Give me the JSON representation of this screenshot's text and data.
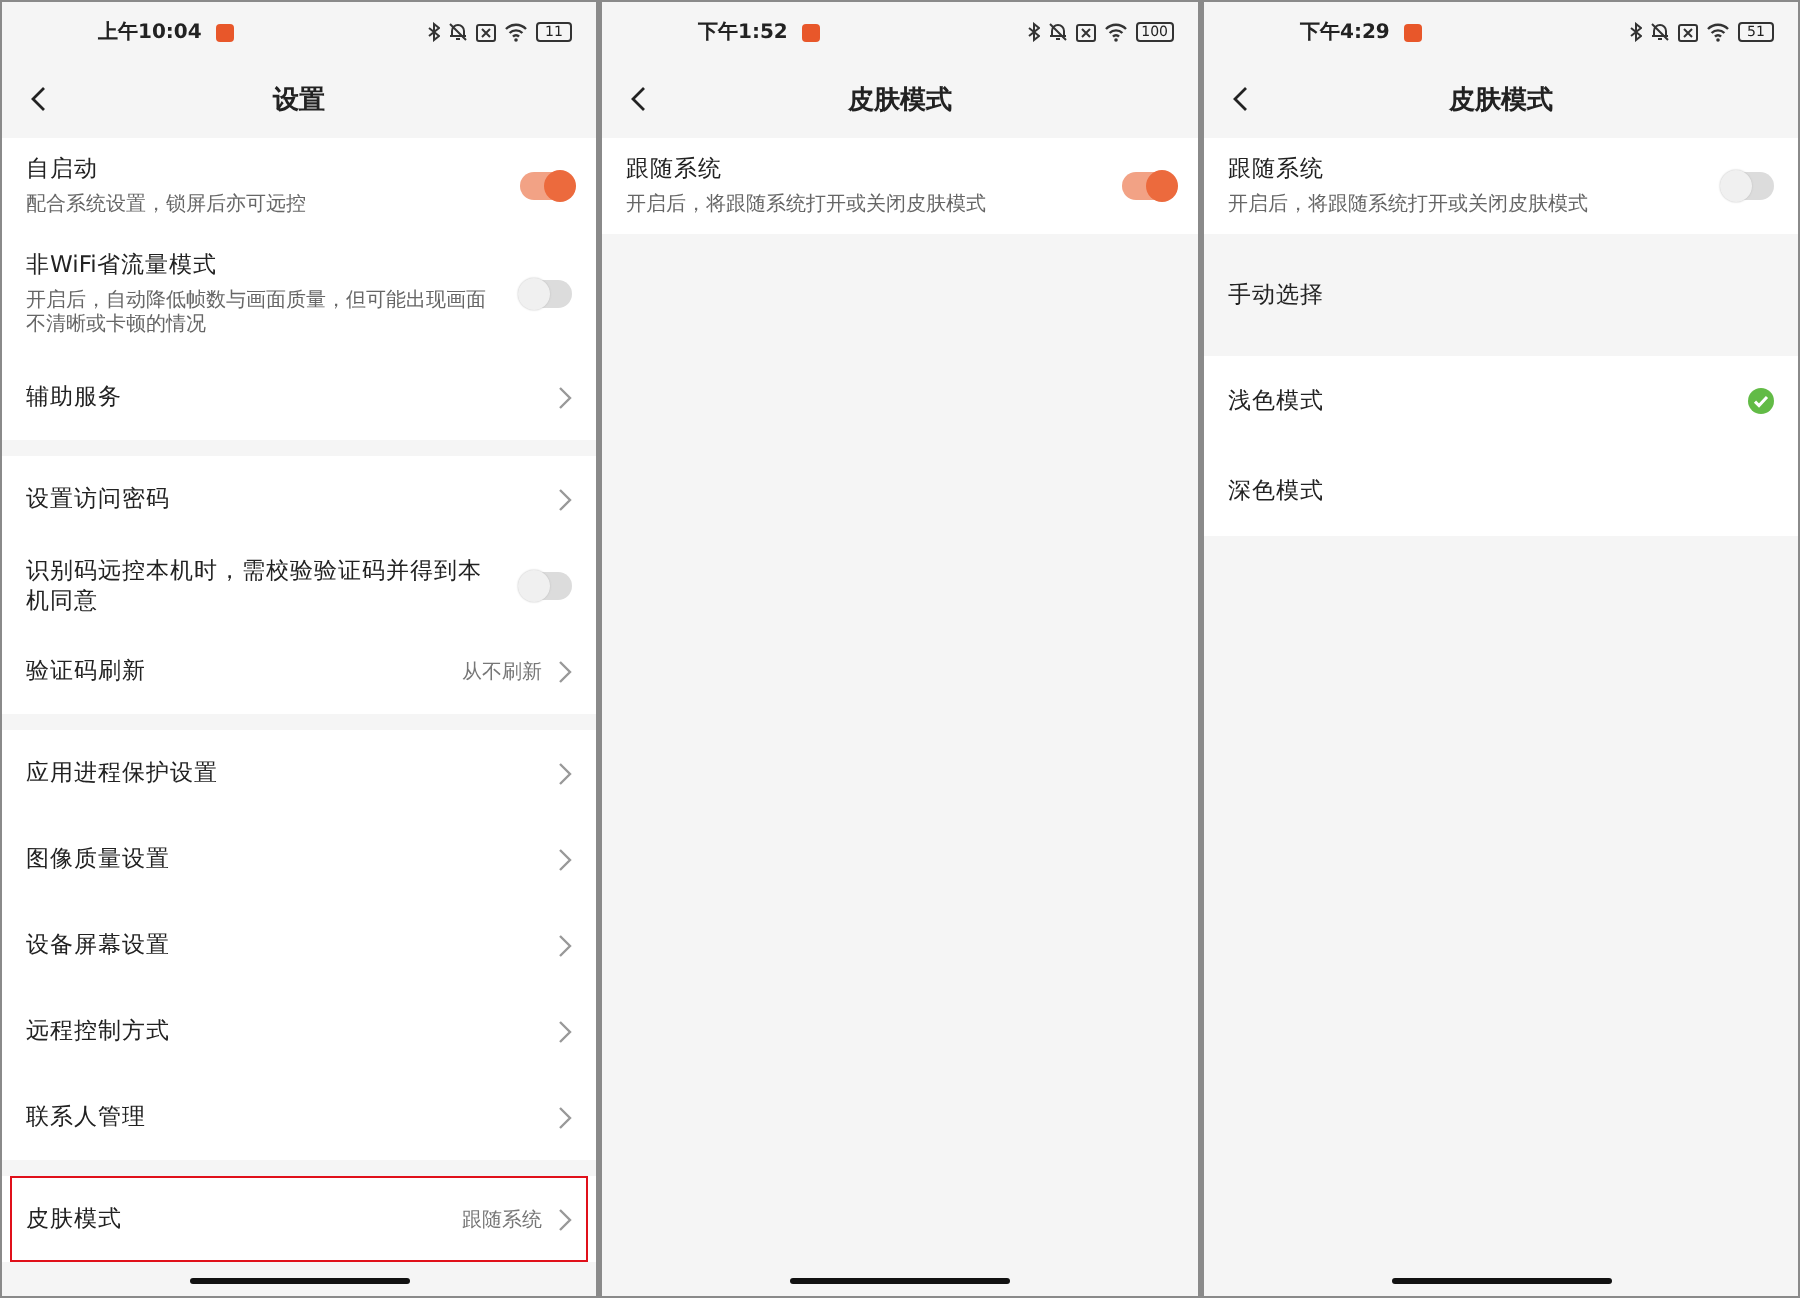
{
  "screens": [
    {
      "status_bar": {
        "time": "上午10:04",
        "battery": "11"
      },
      "header": {
        "title": "设置"
      },
      "groups": [
        {
          "items": [
            {
              "kind": "toggle",
              "title": "自启动",
              "subtitle": "配合系统设置，锁屏后亦可远控",
              "on": true,
              "highlighted": false
            },
            {
              "kind": "toggle",
              "title": "非WiFi省流量模式",
              "subtitle": "开启后，自动降低帧数与画面质量，但可能出现画面不清晰或卡顿的情况",
              "on": false,
              "highlighted": false
            },
            {
              "kind": "link",
              "title": "辅助服务",
              "highlighted": false
            }
          ]
        },
        {
          "items": [
            {
              "kind": "link",
              "title": "设置访问密码",
              "highlighted": false
            },
            {
              "kind": "toggle",
              "title": "识别码远控本机时，需校验验证码并得到本机同意",
              "on": false,
              "highlighted": false
            },
            {
              "kind": "link",
              "title": "验证码刷新",
              "value": "从不刷新",
              "highlighted": false
            }
          ]
        },
        {
          "items": [
            {
              "kind": "link",
              "title": "应用进程保护设置",
              "highlighted": false
            },
            {
              "kind": "link",
              "title": "图像质量设置",
              "highlighted": false
            },
            {
              "kind": "link",
              "title": "设备屏幕设置",
              "highlighted": false
            },
            {
              "kind": "link",
              "title": "远程控制方式",
              "highlighted": false
            },
            {
              "kind": "link",
              "title": "联系人管理",
              "highlighted": false
            }
          ]
        },
        {
          "items": [
            {
              "kind": "link",
              "title": "皮肤模式",
              "value": "跟随系统",
              "highlighted": true
            }
          ]
        }
      ]
    },
    {
      "status_bar": {
        "time": "下午1:52",
        "battery": "100"
      },
      "header": {
        "title": "皮肤模式"
      },
      "groups": [
        {
          "items": [
            {
              "kind": "toggle",
              "title": "跟随系统",
              "subtitle": "开启后，将跟随系统打开或关闭皮肤模式",
              "on": true
            }
          ]
        }
      ]
    },
    {
      "status_bar": {
        "time": "下午4:29",
        "battery": "51"
      },
      "header": {
        "title": "皮肤模式"
      },
      "groups": [
        {
          "items": [
            {
              "kind": "toggle",
              "title": "跟随系统",
              "subtitle": "开启后，将跟随系统打开或关闭皮肤模式",
              "on": false
            }
          ]
        },
        {
          "items": [
            {
              "kind": "section",
              "title": "手动选择"
            }
          ]
        },
        {
          "items": [
            {
              "kind": "choice",
              "title": "浅色模式",
              "selected": true
            },
            {
              "kind": "choice",
              "title": "深色模式",
              "selected": false
            }
          ]
        }
      ]
    }
  ]
}
